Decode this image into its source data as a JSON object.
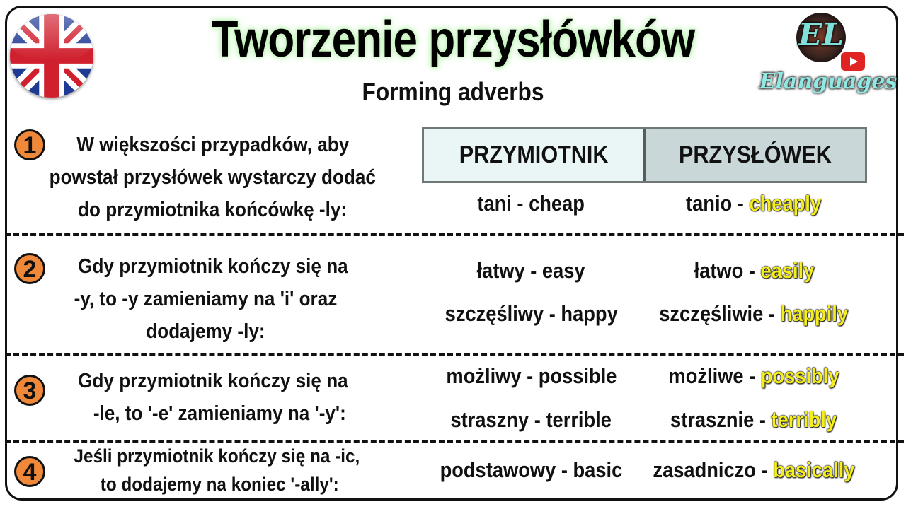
{
  "header": {
    "title": "Tworzenie przysłówków",
    "subtitle": "Forming adverbs",
    "flag": "uk-flag-icon",
    "logo": {
      "monogram": "EL",
      "name": "Elanguages",
      "badge": "youtube-play-icon"
    }
  },
  "table": {
    "headers": {
      "adjective": "PRZYMIOTNIK",
      "adverb": "PRZYSŁÓWEK"
    }
  },
  "colors": {
    "number_badge": "#f0883a",
    "highlight": "#f5ee1a",
    "header_adjective_bg": "#eaf6f6",
    "header_adverb_bg": "#c9d7d8",
    "title_glow": "#b8f0b0"
  },
  "rules": [
    {
      "number": "1",
      "lines": [
        "W większości przypadków, aby",
        "powstał przysłówek wystarczy dodać",
        "do przymiotnika końcówkę -ly:"
      ],
      "examples": [
        {
          "adjective": "tani - cheap",
          "adverb_pl": "tanio - ",
          "adverb_en": "cheaply"
        }
      ]
    },
    {
      "number": "2",
      "lines": [
        "Gdy przymiotnik kończy się na",
        "-y, to -y  zamieniamy na 'i' oraz",
        "dodajemy -ly:"
      ],
      "examples": [
        {
          "adjective": "łatwy - easy",
          "adverb_pl": "łatwo - ",
          "adverb_en": "easily"
        },
        {
          "adjective": "szczęśliwy - happy",
          "adverb_pl": "szczęśliwie - ",
          "adverb_en": "happily"
        }
      ]
    },
    {
      "number": "3",
      "lines": [
        "Gdy przymiotnik kończy się na",
        "-le, to '-e' zamieniamy na '-y':"
      ],
      "examples": [
        {
          "adjective": "możliwy - possible",
          "adverb_pl": "możliwe - ",
          "adverb_en": "possibly"
        },
        {
          "adjective": "straszny - terrible",
          "adverb_pl": "strasznie - ",
          "adverb_en": "terribly"
        }
      ]
    },
    {
      "number": "4",
      "lines": [
        "Jeśli przymiotnik kończy się na -ic,",
        "to dodajemy na koniec '-ally':"
      ],
      "examples": [
        {
          "adjective": "podstawowy - basic",
          "adverb_pl": "zasadniczo - ",
          "adverb_en": "basically"
        }
      ]
    }
  ]
}
